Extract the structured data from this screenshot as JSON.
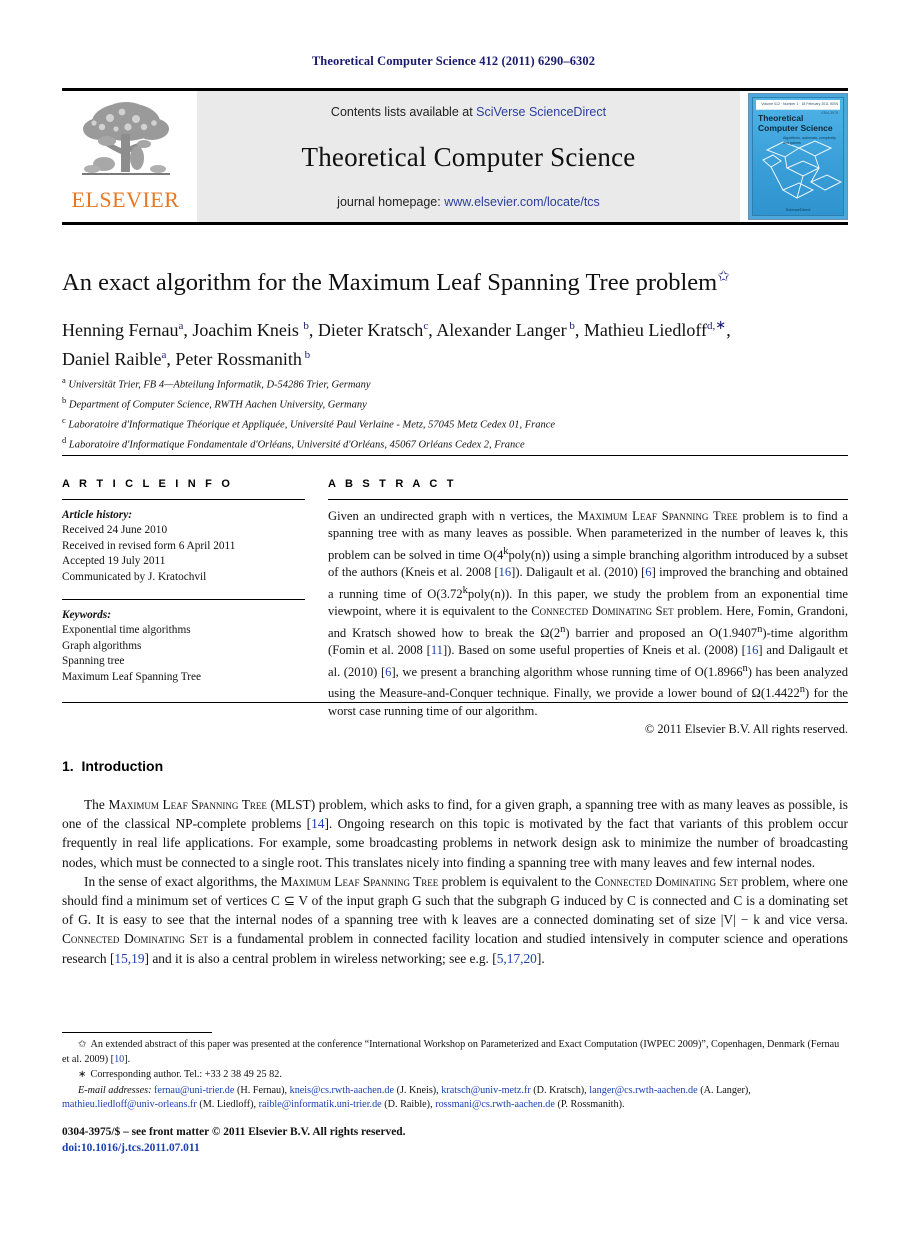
{
  "running_head": "Theoretical Computer Science 412 (2011) 6290–6302",
  "masthead": {
    "publisher": "ELSEVIER",
    "contents_prefix": "Contents lists available at ",
    "contents_link": "SciVerse ScienceDirect",
    "journal_title": "Theoretical Computer Science",
    "homepage_prefix": "journal homepage: ",
    "homepage_link": "www.elsevier.com/locate/tcs",
    "cover": {
      "title_line1": "Theoretical",
      "title_line2": "Computer Science",
      "subtitle": "Algorithms, automata, complexity and games",
      "top_strip": "Volume 412 · Number 1 · 18 February 2011       ISSN 0304-3975",
      "bottom_mark": "ScienceDirect"
    }
  },
  "article": {
    "title": "An exact algorithm for the Maximum Leaf Spanning Tree problem",
    "title_footnote_mark": "✩",
    "authors_line1": "Henning Fernau a, Joachim Kneis b, Dieter Kratsch c, Alexander Langer b, Mathieu Liedloff d,∗,",
    "authors_line2": "Daniel Raible a, Peter Rossmanith b",
    "authors": [
      {
        "name": "Henning Fernau",
        "marks": "a"
      },
      {
        "name": "Joachim Kneis",
        "marks": "b"
      },
      {
        "name": "Dieter Kratsch",
        "marks": "c"
      },
      {
        "name": "Alexander Langer",
        "marks": "b"
      },
      {
        "name": "Mathieu Liedloff",
        "marks": "d,∗"
      },
      {
        "name": "Daniel Raible",
        "marks": "a"
      },
      {
        "name": "Peter Rossmanith",
        "marks": "b"
      }
    ],
    "affiliations": [
      {
        "mark": "a",
        "text": "Universität Trier, FB 4—Abteilung Informatik, D-54286 Trier, Germany"
      },
      {
        "mark": "b",
        "text": "Department of Computer Science, RWTH Aachen University, Germany"
      },
      {
        "mark": "c",
        "text": "Laboratoire d'Informatique Théorique et Appliquée, Université Paul Verlaine - Metz, 57045 Metz Cedex 01, France"
      },
      {
        "mark": "d",
        "text": "Laboratoire d'Informatique Fondamentale d'Orléans, Université d'Orléans, 45067 Orléans Cedex 2, France"
      }
    ]
  },
  "article_info": {
    "heading": "A R T I C L E   I N F O",
    "history_title": "Article history:",
    "history": [
      "Received 24 June 2010",
      "Received in revised form 6 April 2011",
      "Accepted 19 July 2011",
      "Communicated by J. Kratochvil"
    ],
    "keywords_title": "Keywords:",
    "keywords": [
      "Exponential time algorithms",
      "Graph algorithms",
      "Spanning tree",
      "Maximum Leaf Spanning Tree"
    ]
  },
  "abstract": {
    "heading": "A B S T R A C T",
    "text_parts": {
      "p1": "Given an undirected graph with n vertices, the ",
      "sc1": "Maximum Leaf Spanning Tree",
      "p2": " problem is to find a spanning tree with as many leaves as possible. When parameterized in the number of leaves k, this problem can be solved in time O(4",
      "sup_k": "k",
      "p3": "poly(n)) using a simple branching algorithm introduced by a subset of the authors (Kneis et al. 2008 [",
      "ref16a": "16",
      "p4": "]). Daligault et al. (2010) [",
      "ref6a": "6",
      "p5": "] improved the branching and obtained a running time of O(3.72",
      "sup_k2": "k",
      "p6": "poly(n)). In this paper, we study the problem from an exponential time viewpoint, where it is equivalent to the ",
      "sc2": "Connected Dominating Set",
      "p7": " problem. Here, Fomin, Grandoni, and Kratsch showed how to break the Ω(2",
      "sup_n1": "n",
      "p8": ") barrier and proposed an O(1.9407",
      "sup_n2": "n",
      "p9": ")-time algorithm (Fomin et al. 2008 [",
      "ref11": "11",
      "p10": "]). Based on some useful properties of Kneis et al. (2008) [",
      "ref16b": "16",
      "p11": "] and Daligault et al. (2010) [",
      "ref6b": "6",
      "p12": "], we present a branching algorithm whose running time of O(1.8966",
      "sup_n3": "n",
      "p13": ") has been analyzed using the Measure-and-Conquer technique. Finally, we provide a lower bound of Ω(1.4422",
      "sup_n4": "n",
      "p14": ") for the worst case running time of our algorithm."
    },
    "copyright": "© 2011 Elsevier B.V. All rights reserved."
  },
  "introduction": {
    "number": "1.",
    "heading": "Introduction",
    "para1": {
      "a": "The ",
      "sc": "Maximum Leaf Spanning Tree",
      "b": " (MLST) problem, which asks to find, for a given graph, a spanning tree with as many leaves as possible, is one of the classical NP-complete problems [",
      "ref": "14",
      "c": "]. Ongoing research on this topic is motivated by the fact that variants of this problem occur frequently in real life applications. For example, some broadcasting problems in network design ask to minimize the number of broadcasting nodes, which must be connected to a single root. This translates nicely into finding a spanning tree with many leaves and few internal nodes."
    },
    "para2": {
      "a": "In the sense of exact algorithms, the ",
      "sc1": "Maximum Leaf Spanning Tree",
      "b": " problem is equivalent to the ",
      "sc2": "Connected Dominating Set",
      "c": " problem, where one should find a minimum set of vertices C ⊆ V of the input graph G such that the subgraph G induced by C is connected and C is a dominating set of G. It is easy to see that the internal nodes of a spanning tree with k leaves are a connected dominating set of size |V| − k and vice versa. ",
      "sc3": "Connected Dominating Set",
      "d": " is a fundamental problem in connected facility location and studied intensively in computer science and operations research [",
      "ref1": "15,19",
      "e": "] and it is also a central problem in wireless networking; see e.g. [",
      "ref2": "5,17,20",
      "f": "]."
    }
  },
  "footnotes": {
    "star_mark": "✩",
    "star_text_a": "An extended abstract of this paper was presented at the conference “International Workshop on Parameterized and Exact Computation (IWPEC 2009)”, Copenhagen, Denmark (Fernau et al. 2009) [",
    "star_ref": "10",
    "star_text_b": "].",
    "corr_mark": "∗",
    "corr_text": "Corresponding author. Tel.: +33 2 38 49 25 82.",
    "email_label": "E-mail addresses:",
    "emails": [
      {
        "addr": "fernau@uni-trier.de",
        "who": " (H. Fernau), "
      },
      {
        "addr": "kneis@cs.rwth-aachen.de",
        "who": " (J. Kneis), "
      },
      {
        "addr": "kratsch@univ-metz.fr",
        "who": " (D. Kratsch), "
      },
      {
        "addr": "langer@cs.rwth-aachen.de",
        "who": " (A. Langer), "
      },
      {
        "addr": "mathieu.liedloff@univ-orleans.fr",
        "who": " (M. Liedloff), "
      },
      {
        "addr": "raible@informatik.uni-trier.de",
        "who": " (D. Raible), "
      },
      {
        "addr": "rossmani@cs.rwth-aachen.de",
        "who": " (P. Rossmanith)."
      }
    ]
  },
  "imprint": {
    "line1": "0304-3975/$ – see front matter © 2011 Elsevier B.V. All rights reserved.",
    "doi": "doi:10.1016/j.tcs.2011.07.011"
  }
}
